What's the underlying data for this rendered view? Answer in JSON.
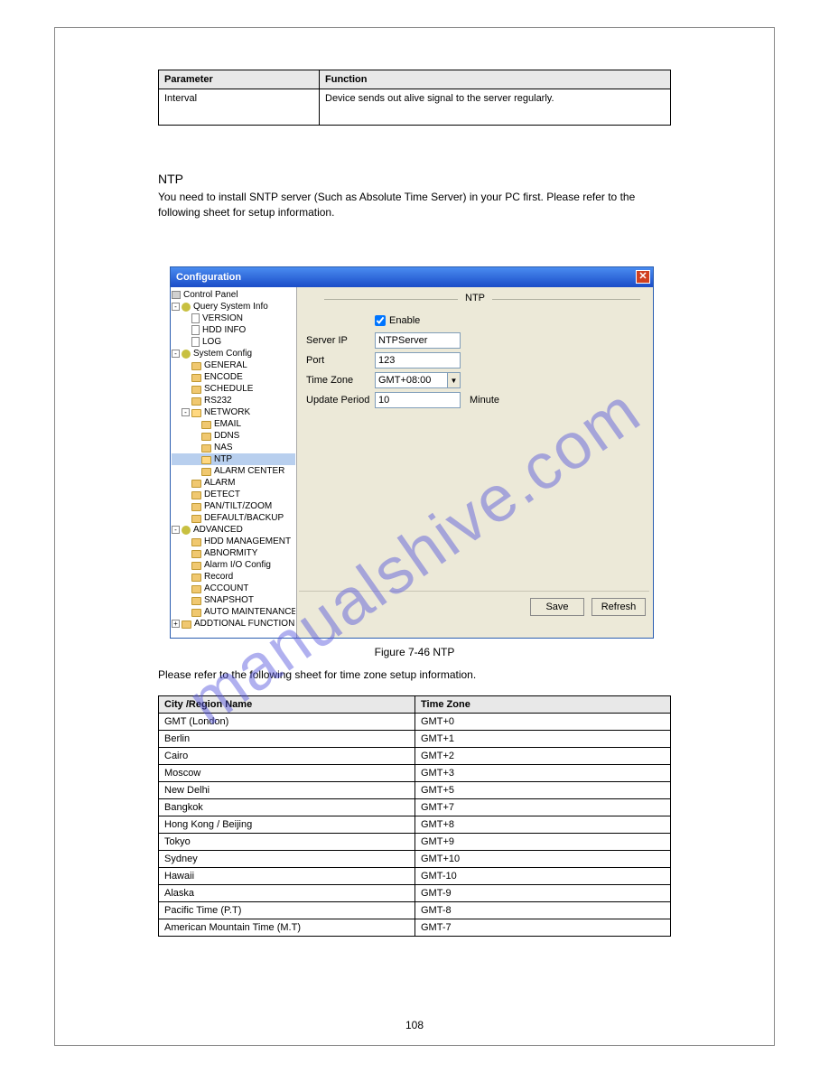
{
  "watermark": "manualshive.com",
  "table_top": {
    "headers": [
      "Parameter",
      "Function"
    ],
    "rows": [
      [
        "Interval",
        "Device sends out alive signal to the server regularly."
      ]
    ]
  },
  "section_title": "NTP",
  "section_body": "You need to install SNTP server (Such as Absolute Time Server) in your PC first. Please refer to the following sheet for setup information.",
  "dialog": {
    "title": "Configuration",
    "control_panel": "Control Panel",
    "pane_title": "NTP",
    "enable_label": "Enable",
    "form": {
      "server_ip": {
        "label": "Server IP",
        "value": "NTPServer"
      },
      "port": {
        "label": "Port",
        "value": "123"
      },
      "time_zone": {
        "label": "Time Zone",
        "value": "GMT+08:00"
      },
      "update_period": {
        "label": "Update Period",
        "value": "10",
        "unit": "Minute"
      }
    },
    "save": "Save",
    "refresh": "Refresh",
    "tree": [
      {
        "label": "Query System Info",
        "icon": "gear",
        "depth": 0,
        "exp": "-"
      },
      {
        "label": "VERSION",
        "icon": "page",
        "depth": 1
      },
      {
        "label": "HDD INFO",
        "icon": "page",
        "depth": 1
      },
      {
        "label": "LOG",
        "icon": "page",
        "depth": 1
      },
      {
        "label": "System Config",
        "icon": "gear",
        "depth": 0,
        "exp": "-"
      },
      {
        "label": "GENERAL",
        "icon": "folder",
        "depth": 1
      },
      {
        "label": "ENCODE",
        "icon": "folder",
        "depth": 1
      },
      {
        "label": "SCHEDULE",
        "icon": "folder",
        "depth": 1
      },
      {
        "label": "RS232",
        "icon": "folder",
        "depth": 1
      },
      {
        "label": "NETWORK",
        "icon": "folder-open",
        "depth": 1,
        "exp": "-"
      },
      {
        "label": "EMAIL",
        "icon": "folder",
        "depth": 2
      },
      {
        "label": "DDNS",
        "icon": "folder",
        "depth": 2
      },
      {
        "label": "NAS",
        "icon": "folder",
        "depth": 2
      },
      {
        "label": "NTP",
        "icon": "folder-open",
        "depth": 2,
        "selected": true
      },
      {
        "label": "ALARM CENTER",
        "icon": "folder",
        "depth": 2
      },
      {
        "label": "ALARM",
        "icon": "folder",
        "depth": 1
      },
      {
        "label": "DETECT",
        "icon": "folder",
        "depth": 1
      },
      {
        "label": "PAN/TILT/ZOOM",
        "icon": "folder",
        "depth": 1
      },
      {
        "label": "DEFAULT/BACKUP",
        "icon": "folder",
        "depth": 1
      },
      {
        "label": "ADVANCED",
        "icon": "gear",
        "depth": 0,
        "exp": "-"
      },
      {
        "label": "HDD MANAGEMENT",
        "icon": "folder",
        "depth": 1
      },
      {
        "label": "ABNORMITY",
        "icon": "folder",
        "depth": 1
      },
      {
        "label": "Alarm I/O Config",
        "icon": "folder",
        "depth": 1
      },
      {
        "label": "Record",
        "icon": "folder",
        "depth": 1
      },
      {
        "label": "ACCOUNT",
        "icon": "folder",
        "depth": 1
      },
      {
        "label": "SNAPSHOT",
        "icon": "folder",
        "depth": 1
      },
      {
        "label": "AUTO MAINTENANCE",
        "icon": "folder",
        "depth": 1
      },
      {
        "label": "ADDTIONAL FUNCTION",
        "icon": "folder",
        "depth": 0,
        "exp": "+"
      }
    ]
  },
  "figure_caption": "Figure 7-46 NTP",
  "after_fig_text": "Please refer to the following sheet for time zone setup information.",
  "table_tz": {
    "headers": [
      "City /Region Name",
      "Time Zone"
    ],
    "rows": [
      [
        "GMT (London)",
        "GMT+0"
      ],
      [
        "Berlin",
        "GMT+1"
      ],
      [
        "Cairo",
        "GMT+2"
      ],
      [
        "Moscow",
        "GMT+3"
      ],
      [
        "New Delhi",
        "GMT+5"
      ],
      [
        "Bangkok",
        "GMT+7"
      ],
      [
        "Hong Kong / Beijing",
        "GMT+8"
      ],
      [
        "Tokyo",
        "GMT+9"
      ],
      [
        "Sydney",
        "GMT+10"
      ],
      [
        "Hawaii",
        "GMT-10"
      ],
      [
        "Alaska",
        "GMT-9"
      ],
      [
        "Pacific Time (P.T)",
        "GMT-8"
      ],
      [
        "American Mountain Time (M.T)",
        "GMT-7"
      ]
    ]
  },
  "page_number": "108"
}
